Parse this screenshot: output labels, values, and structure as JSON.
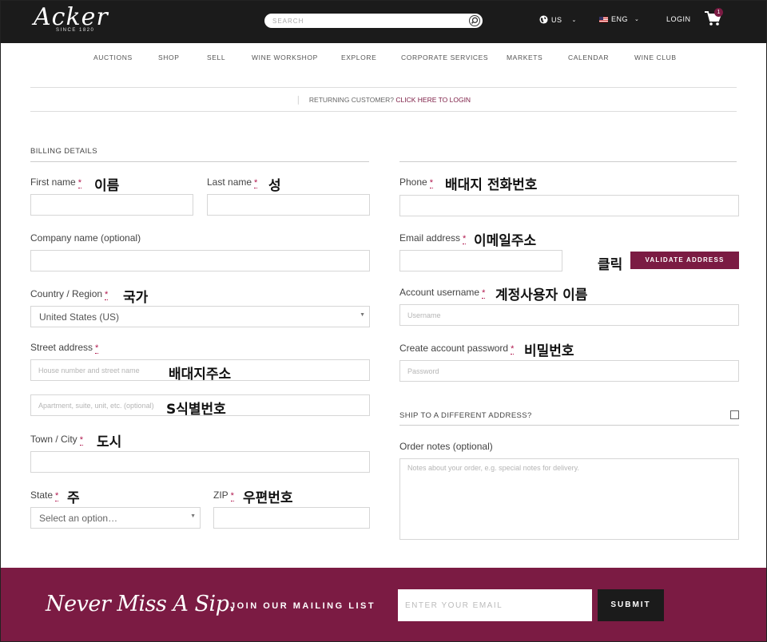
{
  "header": {
    "logo_text": "Acker",
    "logo_since": "SINCE 1820",
    "search_placeholder": "SEARCH",
    "region": "US",
    "language": "ENG",
    "login": "LOGIN",
    "cart_count": "1"
  },
  "nav": [
    "AUCTIONS",
    "SHOP",
    "SELL",
    "WINE WORKSHOP",
    "EXPLORE",
    "CORPORATE SERVICES",
    "MARKETS",
    "CALENDAR",
    "WINE CLUB"
  ],
  "returning": {
    "text": "RETURNING CUSTOMER?",
    "link": "CLICK HERE TO LOGIN"
  },
  "billing": {
    "title": "BILLING DETAILS",
    "first_name": {
      "label": "First name",
      "note": "이름"
    },
    "last_name": {
      "label": "Last name",
      "note": "성"
    },
    "company": {
      "label": "Company name (optional)"
    },
    "country": {
      "label": "Country / Region",
      "note": "국가",
      "value": "United States (US)"
    },
    "street": {
      "label": "Street address",
      "placeholder": "House number and street name",
      "note": "배대지주소",
      "placeholder2": "Apartment, suite, unit, etc. (optional)",
      "note2": "S식별번호"
    },
    "city": {
      "label": "Town / City",
      "note": "도시"
    },
    "state": {
      "label": "State",
      "note": "주",
      "value": "Select an option…"
    },
    "zip": {
      "label": "ZIP",
      "note": "우편번호"
    },
    "required_mark": "*"
  },
  "account": {
    "phone": {
      "label": "Phone",
      "note": "배대지 전화번호"
    },
    "email": {
      "label": "Email address",
      "note": "이메일주소"
    },
    "click_note": "클릭",
    "validate_button": "VALIDATE ADDRESS",
    "username": {
      "label": "Account username",
      "note": "계정사용자 이름",
      "placeholder": "Username"
    },
    "password": {
      "label": "Create account password",
      "note": "비밀번호",
      "placeholder": "Password"
    },
    "ship_different": "SHIP TO A DIFFERENT ADDRESS?",
    "order_notes": {
      "label": "Order notes (optional)",
      "placeholder": "Notes about your order, e.g. special notes for delivery."
    }
  },
  "footer": {
    "tagline": "Never Miss A Sip.",
    "join": "JOIN OUR MAILING LIST",
    "email_placeholder": "ENTER YOUR EMAIL",
    "submit": "SUBMIT"
  },
  "colors": {
    "accent": "#7b1b43",
    "topbar": "#1b1b1b",
    "required": "#b0174d"
  }
}
